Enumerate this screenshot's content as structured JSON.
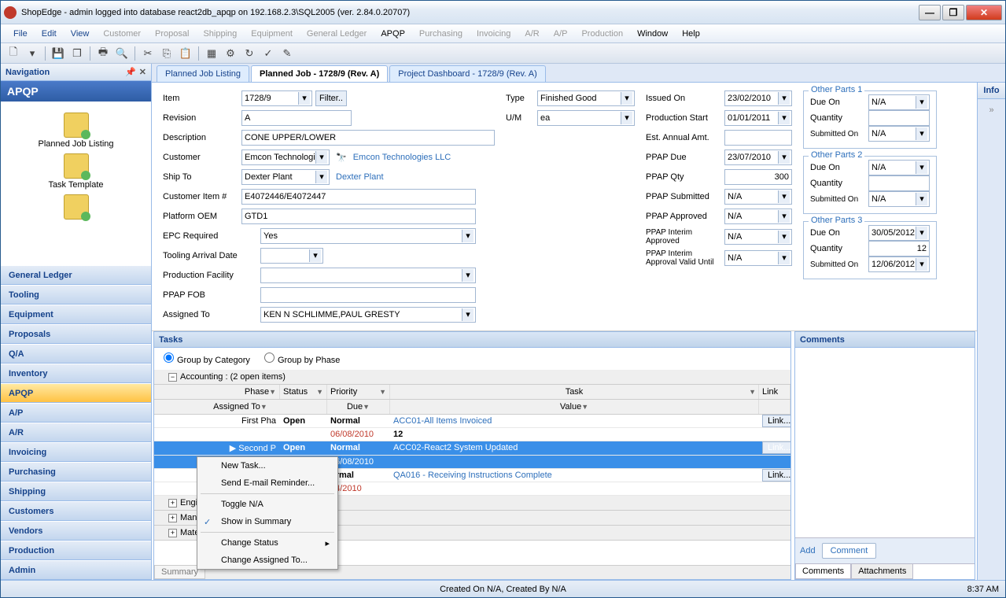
{
  "title": "ShopEdge - admin logged into database react2db_apqp on 192.168.2.3\\SQL2005 (ver. 2.84.0.20707)",
  "menubar": [
    "File",
    "Edit",
    "View",
    "Customer",
    "Proposal",
    "Shipping",
    "Equipment",
    "General Ledger",
    "APQP",
    "Purchasing",
    "Invoicing",
    "A/R",
    "A/P",
    "Production",
    "Window",
    "Help"
  ],
  "menubar_active": [
    "APQP",
    "Window",
    "Help"
  ],
  "nav": {
    "header": "Navigation",
    "title": "APQP",
    "tree": [
      "Planned Job Listing",
      "Task Template"
    ],
    "accordion": [
      "General Ledger",
      "Tooling",
      "Equipment",
      "Proposals",
      "Q/A",
      "Inventory",
      "APQP",
      "A/P",
      "A/R",
      "Invoicing",
      "Purchasing",
      "Shipping",
      "Customers",
      "Vendors",
      "Production",
      "Admin"
    ],
    "selected": "APQP"
  },
  "tabs": [
    {
      "label": "Planned Job Listing",
      "active": false
    },
    {
      "label": "Planned Job - 1728/9 (Rev. A)",
      "active": true
    },
    {
      "label": "Project Dashboard - 1728/9 (Rev. A)",
      "active": false
    }
  ],
  "form": {
    "item_label": "Item",
    "item": "1728/9",
    "filter": "Filter..",
    "revision_label": "Revision",
    "revision": "A",
    "description_label": "Description",
    "description": "CONE UPPER/LOWER",
    "customer_label": "Customer",
    "customer": "Emcon Technologi",
    "customer_link": "Emcon Technologies LLC",
    "shipto_label": "Ship To",
    "shipto": "Dexter Plant",
    "shipto_link": "Dexter Plant",
    "custitem_label": "Customer Item #",
    "custitem": "E4072446/E4072447",
    "platform_label": "Platform OEM",
    "platform": "GTD1",
    "epc_label": "EPC Required",
    "epc": "Yes",
    "tooling_label": "Tooling Arrival Date",
    "tooling": "",
    "facility_label": "Production Facility",
    "facility": "",
    "ppapfob_label": "PPAP FOB",
    "ppapfob": "",
    "assigned_label": "Assigned To",
    "assigned": "KEN N SCHLIMME,PAUL GRESTY",
    "type_label": "Type",
    "type": "Finished Good",
    "um_label": "U/M",
    "um": "ea",
    "issued_label": "Issued On",
    "issued": "23/02/2010",
    "prodstart_label": "Production Start",
    "prodstart": "01/01/2011",
    "estamount_label": "Est. Annual Amt.",
    "estamount": "",
    "ppapdue_label": "PPAP Due",
    "ppapdue": "23/07/2010",
    "ppapqty_label": "PPAP Qty",
    "ppapqty": "300",
    "ppapsub_label": "PPAP Submitted",
    "ppapsub": "N/A",
    "ppapapp_label": "PPAP Approved",
    "ppapapp": "N/A",
    "ppapint_label": "PPAP Interim Approved",
    "ppapint": "N/A",
    "ppapintv_label": "PPAP Interim Approval Valid Until",
    "ppapintv": "N/A"
  },
  "other_parts": [
    {
      "title": "Other Parts 1",
      "due": "N/A",
      "qty": "",
      "sub": "N/A"
    },
    {
      "title": "Other Parts 2",
      "due": "N/A",
      "qty": "",
      "sub": "N/A"
    },
    {
      "title": "Other Parts 3",
      "due": "30/05/2012",
      "qty": "12",
      "sub": "12/06/2012"
    }
  ],
  "op_labels": {
    "due": "Due On",
    "qty": "Quantity",
    "sub": "Submitted On"
  },
  "tasks": {
    "header": "Tasks",
    "radio1": "Group by Category",
    "radio2": "Group by Phase",
    "group": "Accounting : (2 open items)",
    "columns": [
      "Phase",
      "Status",
      "Priority",
      "Task",
      "Link"
    ],
    "subcolumns": [
      "Assigned To",
      "Due",
      "Value"
    ],
    "rows": [
      {
        "phase": "First Pha",
        "status": "Open",
        "priority": "Normal",
        "task": "ACC01-All Items Invoiced",
        "due": "06/08/2010",
        "value": "12",
        "link": "Link...",
        "sel": false
      },
      {
        "phase": "Second P",
        "status": "Open",
        "priority": "Normal",
        "task": "ACC02-React2 System Updated",
        "due": "06/08/2010",
        "value": "",
        "link": "Link...",
        "sel": true
      },
      {
        "phase": "",
        "status": "",
        "priority": "ormal",
        "task": "QA016 - Receiving Instructions Complete",
        "due": "04/2010",
        "value": "",
        "link": "Link...",
        "sel": false
      }
    ],
    "subgroups": [
      "Engine",
      "Manufa",
      "Materi"
    ],
    "bottom_tab": "Summary"
  },
  "context_menu": [
    "New Task...",
    "Send E-mail Reminder...",
    "Toggle N/A",
    "Show in Summary",
    "Change Status",
    "Change Assigned To..."
  ],
  "comments": {
    "header": "Comments",
    "add": "Add",
    "btn": "Comment",
    "tab1": "Comments",
    "tab2": "Attachments"
  },
  "info_label": "Info",
  "statusbar": {
    "center": "Created On N/A, Created By N/A",
    "time": "8:37 AM"
  }
}
